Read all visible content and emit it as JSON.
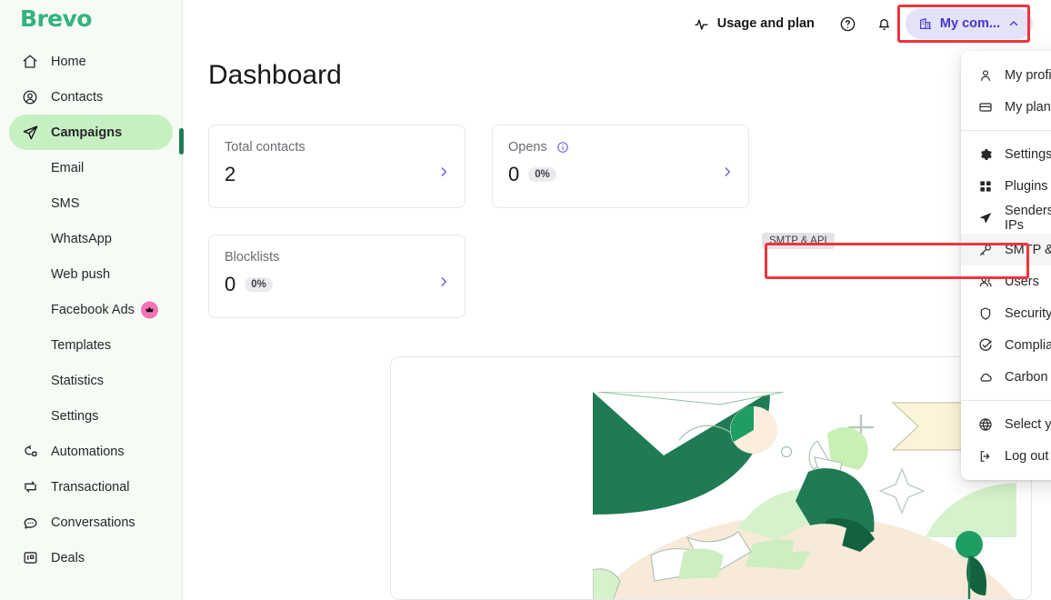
{
  "brand": {
    "name": "Brevo"
  },
  "sidebar": {
    "items": [
      {
        "label": "Home",
        "icon": "home-icon",
        "type": "top",
        "active": false
      },
      {
        "label": "Contacts",
        "icon": "contacts-icon",
        "type": "top",
        "active": false
      },
      {
        "label": "Campaigns",
        "icon": "campaigns-send-icon",
        "type": "top",
        "active": true
      },
      {
        "label": "Email",
        "icon": "",
        "type": "sub",
        "active": false
      },
      {
        "label": "SMS",
        "icon": "",
        "type": "sub",
        "active": false
      },
      {
        "label": "WhatsApp",
        "icon": "",
        "type": "sub",
        "active": false
      },
      {
        "label": "Web push",
        "icon": "",
        "type": "sub",
        "active": false
      },
      {
        "label": "Facebook Ads",
        "icon": "",
        "type": "sub",
        "active": false,
        "badge": "crown-icon"
      },
      {
        "label": "Templates",
        "icon": "",
        "type": "sub",
        "active": false
      },
      {
        "label": "Statistics",
        "icon": "",
        "type": "sub",
        "active": false
      },
      {
        "label": "Settings",
        "icon": "",
        "type": "sub",
        "active": false
      },
      {
        "label": "Automations",
        "icon": "automations-icon",
        "type": "top",
        "active": false
      },
      {
        "label": "Transactional",
        "icon": "transactional-icon",
        "type": "top",
        "active": false
      },
      {
        "label": "Conversations",
        "icon": "conversations-icon",
        "type": "top",
        "active": false
      },
      {
        "label": "Deals",
        "icon": "deals-icon",
        "type": "top",
        "active": false
      }
    ]
  },
  "topbar": {
    "usage_and_plan": "Usage and plan",
    "usage_icon": "activity-pulse-icon",
    "help_icon": "help-circle-icon",
    "notifications_icon": "bell-icon",
    "company": {
      "label": "My com...",
      "icon": "company-building-icon",
      "chevron": "chevron-up-icon",
      "bg_color": "#e4e2f8",
      "text_color": "#4338ca"
    }
  },
  "page": {
    "title": "Dashboard"
  },
  "cards": [
    {
      "label": "Total contacts",
      "value": "2",
      "pct": "",
      "info": false,
      "arrow": "chevron-right-icon"
    },
    {
      "label": "Opens",
      "value": "0",
      "pct": "0%",
      "info": true,
      "arrow": "chevron-right-icon"
    },
    {
      "label": "Blocklists",
      "value": "0",
      "pct": "0%",
      "info": false,
      "arrow": "chevron-right-icon"
    }
  ],
  "tooltip": {
    "text": "SMTP & API"
  },
  "dropdown": {
    "groups": [
      {
        "items": [
          {
            "label": "My profile",
            "icon": "person-icon",
            "highlighted": false
          },
          {
            "label": "My plan",
            "icon": "card-icon",
            "highlighted": false
          }
        ]
      },
      {
        "items": [
          {
            "label": "Settings",
            "icon": "gear-icon",
            "highlighted": false
          },
          {
            "label": "Plugins & Integrations",
            "icon": "grid-apps-icon",
            "highlighted": false
          },
          {
            "label": "Senders, Domains & Dedicated IPs",
            "icon": "send-icon",
            "highlighted": false
          },
          {
            "label": "SMTP & API",
            "icon": "key-icon",
            "highlighted": true
          },
          {
            "label": "Users",
            "icon": "users-icon",
            "highlighted": false
          },
          {
            "label": "Security",
            "icon": "shield-icon",
            "highlighted": false
          },
          {
            "label": "Compliance",
            "icon": "check-circle-icon",
            "highlighted": false
          },
          {
            "label": "Carbon footprint",
            "icon": "cloud-icon",
            "highlighted": false
          }
        ]
      },
      {
        "items": [
          {
            "label": "Select your language",
            "icon": "globe-icon",
            "highlighted": false
          },
          {
            "label": "Log out",
            "icon": "logout-icon",
            "highlighted": false
          }
        ]
      }
    ]
  },
  "annotations": {
    "highlight_color": "#f0343c",
    "company_button_box": "highlight-company-button",
    "smtp_api_box": "highlight-smtp-api-item"
  },
  "illustration": {
    "name": "person-relaxing-on-hill-illustration"
  }
}
